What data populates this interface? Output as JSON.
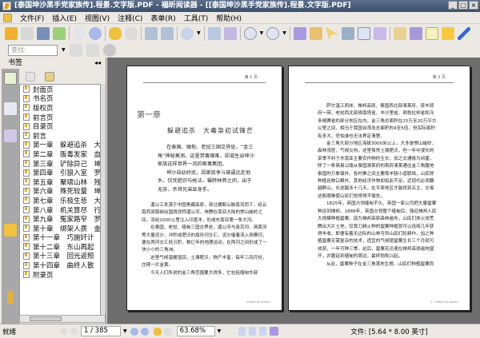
{
  "window": {
    "title": "[泰国坤沙黑手党家族传].程景.文字版.PDF - 福昕阅读器 - [[泰国坤沙黑手党家族传].程景.文字版.PDF]"
  },
  "menu": [
    "文件(F)",
    "插入(E)",
    "视图(V)",
    "注释(C)",
    "表单(R)",
    "工具(T)",
    "帮助(H)"
  ],
  "search": {
    "placeholder": "查找:"
  },
  "sidebar": {
    "title": "书签",
    "bookmarks": [
      "封面页",
      "书名页",
      "版权页",
      "前言页",
      "目录页",
      "前言",
      "第一章　躲避追杀　大毒枭",
      "第二章　贩毒发家　血洗",
      "第三章　铲除异己　坤沙",
      "第四章　引狼入室　罗星汉",
      "第五章　聚啸山林　残军",
      "第六章　殊死较量　坤沙",
      "第七章　乐极生悲　大毒枭",
      "第八章　机关算尽　行刺",
      "第九章　冤家路窄　罗星汉",
      "第十章　绑架人质　金三角",
      "第十一章　巧施奸计　大毒",
      "第十二章　东山再起　武装",
      "第十三章　回光返照　“开",
      "第十四章　曲终人散　坤沙",
      "附录页"
    ]
  },
  "pages": [
    {
      "header": "第 1 页",
      "chapter": "第一章",
      "subtitle": "躲避追杀　大毒枭初试锋芒",
      "intro": [
        "在泰国、缅甸、老挝三国交界处，“金三角”神秘莫测。这里禁毒艰难，却滋生出坤沙家族这样世界一流的贩毒集团。",
        "坤沙自幼好武，因家族争斗被逼远走他乡。仅凭胆识与枪法，辗转林莽之间，出于无奈，杀将兄弟显身手。"
      ],
      "body": [
        "湄公江发源于中国青藏高原，穿过横断山脉南流而下，经云南西双版纳出国境改称湄公河，奔腾在南亚大陆的崇山峻岭之间，流经2000公里注入印度洋，形成东南亚第一条大河。",
        "在泰国、老挝、缅甸三国交界处，湄公河与洛克河、清莱河等大量泥沙，冲积成肥沃的扇形河交汇，泥沙催着流入扬赛河，便在两河交汇处沉积，数亿年的地理运动，在两河之间形成了一块小小的三角洲。",
        "这里气候温暖湿润，土壤肥沃，物产丰富，每年三四月份，庄稼一片金黄。",
        "今天人们所说的金三角范围要大得多，它包括缅甸东部"
      ],
      "footer": "· Edited by Abeles ·"
    },
    {
      "header": "第 2 页",
      "body": [
        "萨尔温江西岸、掸邦高原、泰国西北部清莱府、夜丰颂府一带，老挝西北部琅南塔省、丰沙里省、琅勃拉邦省和乌多姆赛省的部分地区在内。金三角总面积在15万至20万平方公里之间，相当于我国台湾岛总面积的4至5倍，但实际面积有多大，恐怕谁也无法界定清楚。",
        "金三角大部分地区海拔3000米以上，大多是崇山峻岭，森林茂密，气候炎热，这里虽然土壤肥沃，但一年中漫长的旱季不利于东南亚主要农作物的生长，加之交通极为闭塞，除了一条简易公路从泰国清莱府的首府清莱通往金三角腹地泰国的万象镇外，各村寨之间主要靠羊肠小道联络，山民除种植谷物口粮外，其他经济作物却如此不足，近现代必须翻越群山，长途跋涉十几天，在平原地区才能找到买主，交易这般艰难使山民们觉得得不偿失。",
        "1825年，英国占领缅甸不久，英国一家公司把大量罂粟种运到掸邦。1886年，英国占领整个缅甸后，强迫掸邦人民大规模种植罂粟，因为掸邦高原森林遍布，山民们放火烧荒腾出大片土地，仅靠刀耕火种的罂粟种植就可以连续几年获得丰收，即便有着无边际的山林可供山民们轮耕作，加之种植罂粟无需复杂的技术，适宜的气候使罂粟生长三个月就可收获，一年可种三季。此后，罂粟花迅速在掸邦高原遍地盛开，并蔓延到缅甸的周边，最终勃勃兴起。",
        "从此，罂粟种子在金三角落地生根，山民们种植罂粟而"
      ],
      "footer": "2 · Edited by Abeles ·"
    }
  ],
  "status": {
    "ready": "就绪",
    "page": "1 / 385",
    "zoom": "63.68%",
    "file_size": "文件: [5.64 * 8.00 英寸]"
  }
}
